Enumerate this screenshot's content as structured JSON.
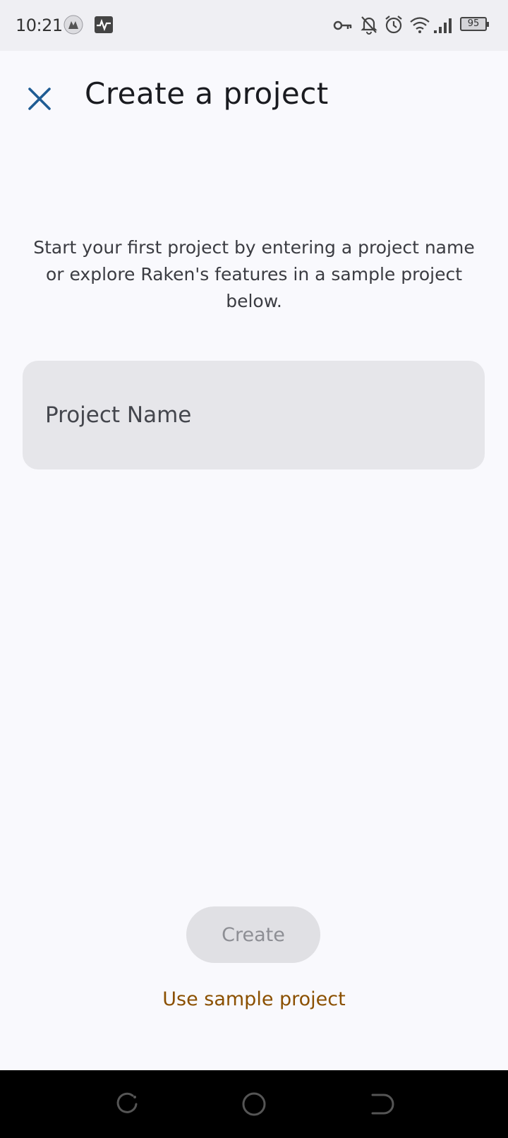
{
  "status_bar": {
    "time": "10:21",
    "battery_level": "95",
    "icons": [
      "vpn-icon",
      "activity-monitor-icon",
      "key-icon",
      "notifications-off-icon",
      "alarm-icon",
      "wifi-icon",
      "cellular-signal-icon",
      "battery-icon"
    ]
  },
  "header": {
    "title": "Create a project",
    "close_icon": "close-icon",
    "accent_color": "#1f5c94"
  },
  "main": {
    "intro_text": "Start your first project by entering a project name or explore Raken's features in a sample project below.",
    "project_name_placeholder": "Project Name",
    "project_name_value": ""
  },
  "footer": {
    "create_label": "Create",
    "create_enabled": false,
    "sample_link_label": "Use sample project",
    "sample_link_color": "#8b5000"
  },
  "nav_bar": {
    "buttons": [
      "recent-apps-icon",
      "home-icon",
      "back-icon"
    ]
  }
}
